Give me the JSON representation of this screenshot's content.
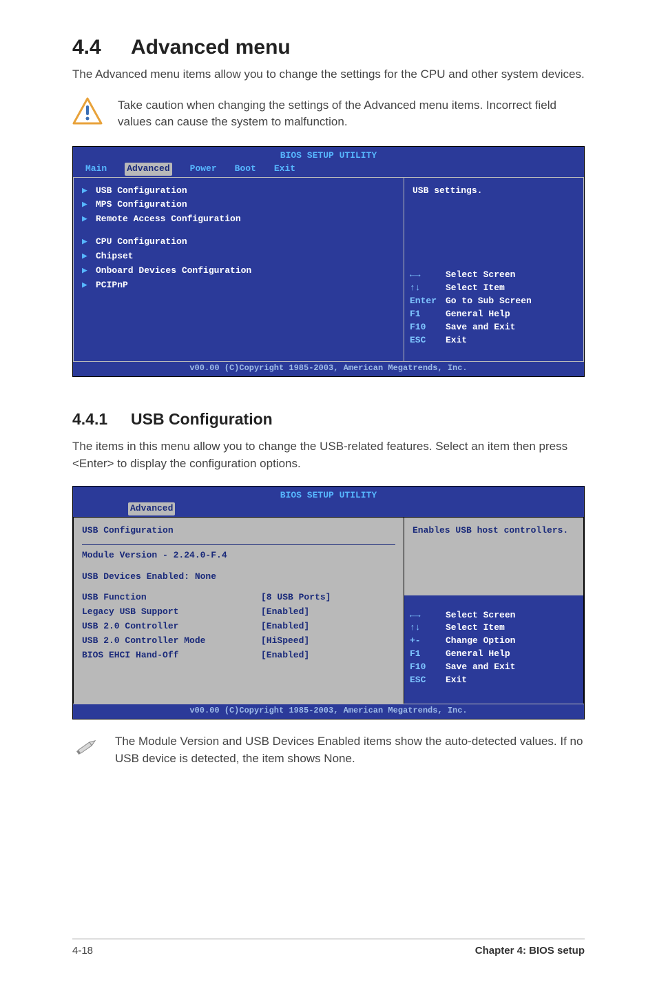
{
  "heading": {
    "number": "4.4",
    "title": "Advanced menu"
  },
  "intro": "The Advanced menu items allow you to change the settings for the CPU and other system devices.",
  "caution": "Take caution when changing the settings of the Advanced menu items. Incorrect field values can cause the system to malfunction.",
  "bios1": {
    "title": "BIOS SETUP UTILITY",
    "tabs": [
      "Main",
      "Advanced",
      "Power",
      "Boot",
      "Exit"
    ],
    "active_tab": "Advanced",
    "items_group1": [
      "USB Configuration",
      "MPS Configuration",
      "Remote Access Configuration"
    ],
    "items_group2": [
      "CPU Configuration",
      "Chipset",
      "Onboard Devices Configuration",
      "PCIPnP"
    ],
    "help": "USB settings.",
    "keys": [
      {
        "k": "←→",
        "d": "Select Screen"
      },
      {
        "k": "↑↓",
        "d": "Select Item"
      },
      {
        "k": "Enter",
        "d": "Go to Sub Screen"
      },
      {
        "k": "F1",
        "d": "General Help"
      },
      {
        "k": "F10",
        "d": "Save and Exit"
      },
      {
        "k": "ESC",
        "d": "Exit"
      }
    ],
    "copyright": "v00.00 (C)Copyright 1985-2003, American Megatrends, Inc."
  },
  "subsection": {
    "number": "4.4.1",
    "title": "USB Configuration"
  },
  "sub_body": "The items in this menu allow you to change the USB-related features. Select an item then press <Enter> to display the configuration options.",
  "bios2": {
    "title": "BIOS SETUP UTILITY",
    "tab": "Advanced",
    "section": "USB Configuration",
    "module": "Module Version - 2.24.0-F.4",
    "devices": "USB Devices Enabled: None",
    "pairs": [
      {
        "lbl": "USB Function",
        "val": "[8 USB Ports]"
      },
      {
        "lbl": "Legacy USB Support",
        "val": "[Enabled]"
      },
      {
        "lbl": "USB 2.0 Controller",
        "val": "[Enabled]"
      },
      {
        "lbl": "USB 2.0 Controller Mode",
        "val": "[HiSpeed]"
      },
      {
        "lbl": "BIOS EHCI Hand-Off",
        "val": "[Enabled]"
      }
    ],
    "help": "Enables USB host controllers.",
    "keys": [
      {
        "k": "←→",
        "d": "Select Screen"
      },
      {
        "k": "↑↓",
        "d": "Select Item"
      },
      {
        "k": "+-",
        "d": "Change Option"
      },
      {
        "k": "F1",
        "d": "General Help"
      },
      {
        "k": "F10",
        "d": "Save and Exit"
      },
      {
        "k": "ESC",
        "d": "Exit"
      }
    ],
    "copyright": "v00.00 (C)Copyright 1985-2003, American Megatrends, Inc."
  },
  "note": "The Module Version and USB Devices Enabled items show the auto-detected values. If no USB device is detected, the item shows None.",
  "footer": {
    "left": "4-18",
    "right": "Chapter 4: BIOS setup"
  }
}
